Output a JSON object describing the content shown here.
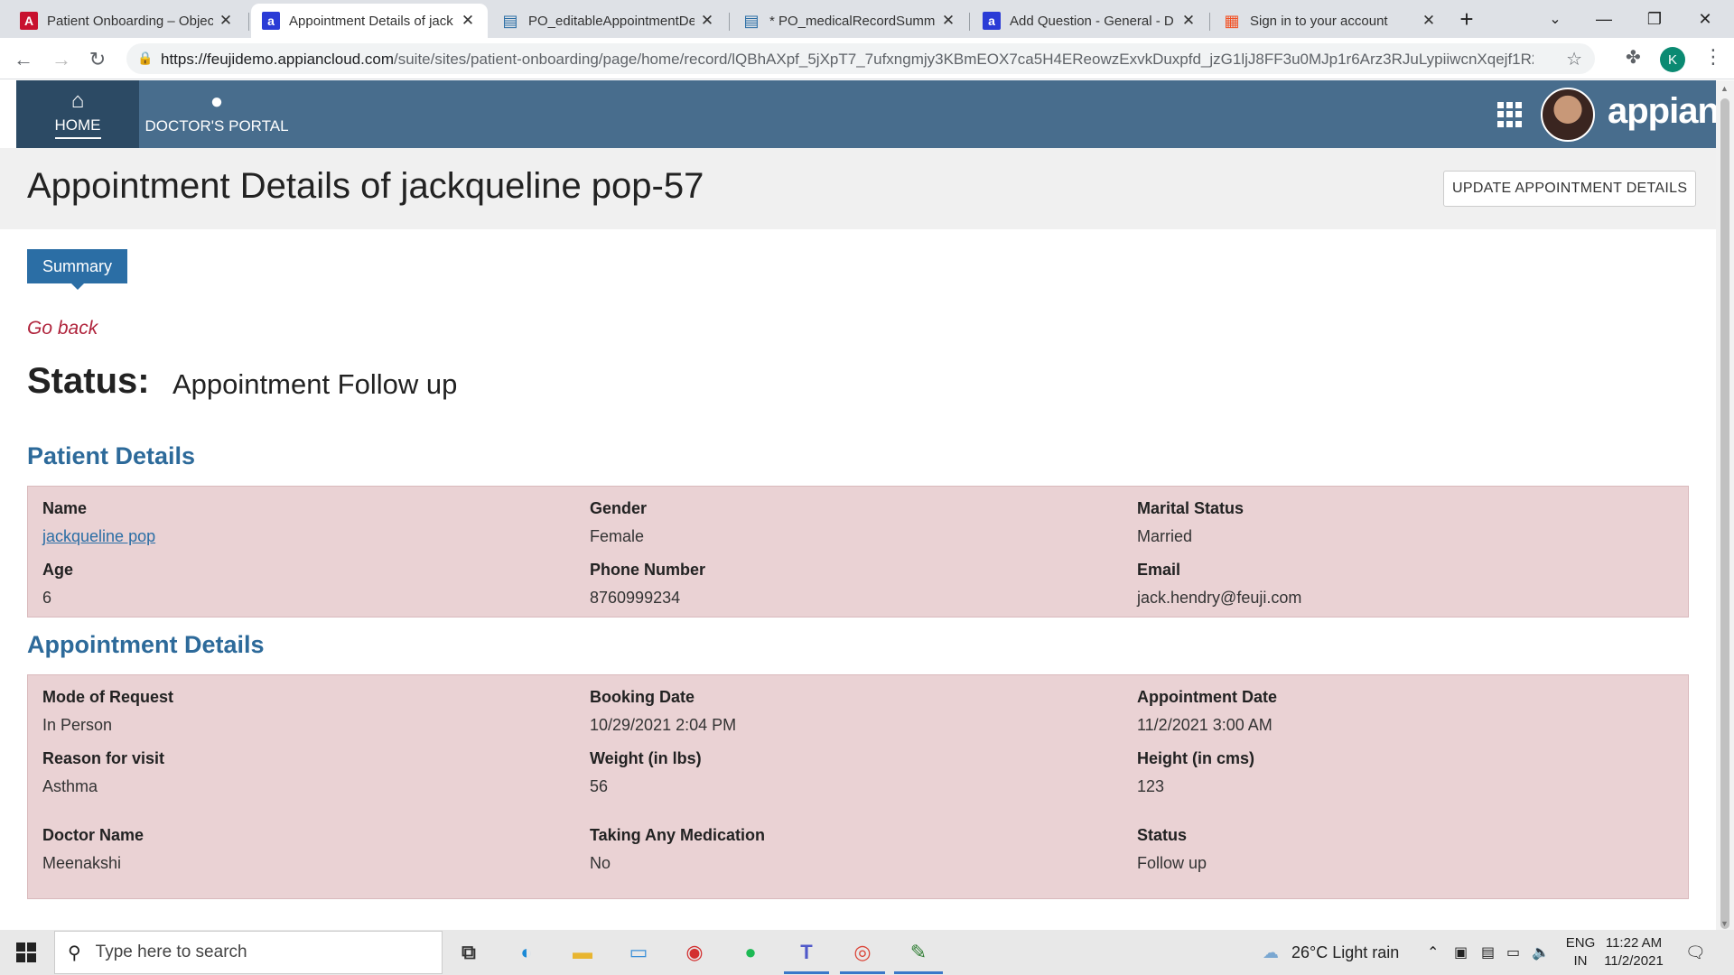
{
  "browser": {
    "tabs": [
      {
        "title": "Patient Onboarding – Objec",
        "favicon": "A",
        "favicon_color": "#c8102e"
      },
      {
        "title": "Appointment Details of jack",
        "favicon": "a",
        "favicon_color": "#2a3bd6"
      },
      {
        "title": "PO_editableAppointmentDe",
        "favicon": "▤",
        "favicon_color": "#2b6ea5"
      },
      {
        "title": "* PO_medicalRecordSumma",
        "favicon": "▤",
        "favicon_color": "#2b6ea5"
      },
      {
        "title": "Add Question - General - D",
        "favicon": "a",
        "favicon_color": "#2a3bd6"
      },
      {
        "title": "Sign in to your account",
        "favicon": "▦",
        "favicon_color": "#f25022"
      }
    ],
    "url_host": "https://feujidemo.appiancloud.com",
    "url_path": "/suite/sites/patient-onboarding/page/home/record/lQBhAXpf_5jXpT7_7ufxngmjy3KBmEOX7ca5H4EReowzExvkDuxpfd_jzG1ljJ8FF3u0MJp1r6Arz3RJuLypiiwcnXqejf1R2...",
    "profile_initial": "K"
  },
  "app": {
    "nav": [
      {
        "label": "HOME",
        "icon": "home-icon"
      },
      {
        "label": "DOCTOR'S PORTAL",
        "icon": "user-icon"
      }
    ],
    "logo": "appian"
  },
  "page": {
    "title": "Appointment Details of jackqueline pop-57",
    "update_button": "UPDATE APPOINTMENT DETAILS",
    "summary_tab": "Summary",
    "go_back": "Go back",
    "status_label": "Status:",
    "status_value": "Appointment Follow up"
  },
  "patient": {
    "heading": "Patient Details",
    "fields": [
      {
        "label": "Name",
        "value": "jackqueline pop"
      },
      {
        "label": "Gender",
        "value": "Female"
      },
      {
        "label": "Marital Status",
        "value": "Married"
      },
      {
        "label": "Age",
        "value": "6"
      },
      {
        "label": "Phone Number",
        "value": "8760999234"
      },
      {
        "label": "Email",
        "value": "jack.hendry@feuji.com"
      }
    ]
  },
  "appointment": {
    "heading": "Appointment Details",
    "fields": [
      {
        "label": "Mode of Request",
        "value": "In Person"
      },
      {
        "label": "Booking Date",
        "value": "10/29/2021 2:04 PM"
      },
      {
        "label": "Appointment Date",
        "value": "11/2/2021 3:00 AM"
      },
      {
        "label": "Reason for visit",
        "value": "Asthma"
      },
      {
        "label": "Weight (in lbs)",
        "value": "56"
      },
      {
        "label": "Height (in cms)",
        "value": "123"
      },
      {
        "label": "Doctor Name",
        "value": "Meenakshi"
      },
      {
        "label": "Taking Any Medication",
        "value": "No"
      },
      {
        "label": "Status",
        "value": "Follow up"
      }
    ]
  },
  "taskbar": {
    "search_placeholder": "Type here to search",
    "weather": "26°C  Light rain",
    "lang_line1": "ENG",
    "lang_line2": "IN",
    "time": "11:22 AM",
    "date": "11/2/2021"
  }
}
